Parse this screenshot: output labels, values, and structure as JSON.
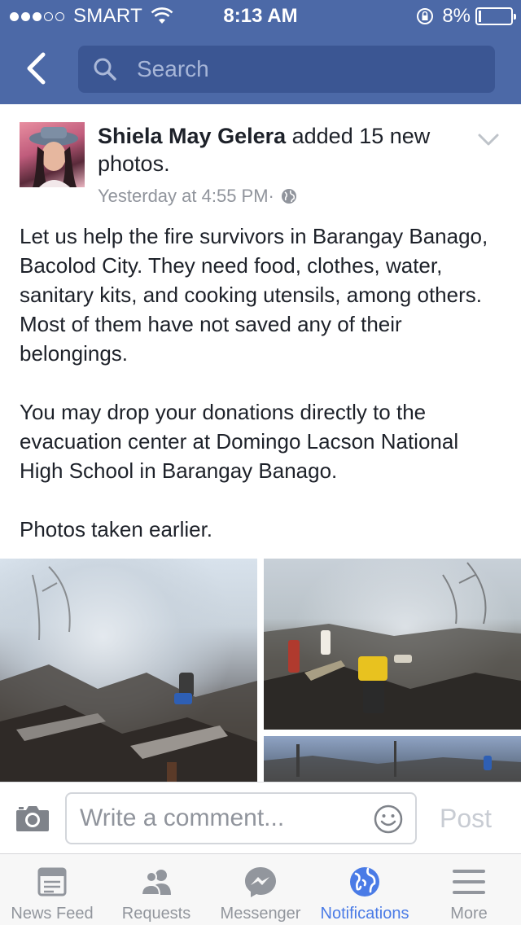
{
  "status_bar": {
    "carrier": "SMART",
    "time": "8:13 AM",
    "battery": "8%",
    "signal_bars_filled": 3,
    "signal_bars_total": 5,
    "battery_level": 0.08
  },
  "nav": {
    "search_placeholder": "Search",
    "icons": {
      "back": "chevron-left-icon",
      "search": "search-icon"
    }
  },
  "post": {
    "author": "Shiela May Gelera",
    "action": " added 15 new photos.",
    "timestamp": "Yesterday at 4:55 PM",
    "separator": " · ",
    "audience_icon": "globe-icon",
    "paragraphs": [
      "Let us help the fire survivors in Barangay Banago, Bacolod City. They need food, clothes, water, sanitary kits, and cooking utensils, among others. Most of them have not saved any of their belongings.",
      "You may drop your donations directly to the evacuation center at Domingo Lacson National High School in Barangay Banago.",
      "Photos taken earlier."
    ]
  },
  "comment_bar": {
    "placeholder": "Write a comment...",
    "post_label": "Post",
    "icons": {
      "camera": "camera-icon",
      "emoji": "smiley-icon"
    }
  },
  "tabs": [
    {
      "label": "News Feed",
      "icon": "news-feed-icon",
      "active": false
    },
    {
      "label": "Requests",
      "icon": "requests-icon",
      "active": false
    },
    {
      "label": "Messenger",
      "icon": "messenger-icon",
      "active": false
    },
    {
      "label": "Notifications",
      "icon": "globe-icon",
      "active": true
    },
    {
      "label": "More",
      "icon": "menu-icon",
      "active": false
    }
  ],
  "colors": {
    "header": "#4c69a7",
    "active_tab": "#4a7be6",
    "inactive_tab": "#92969d"
  }
}
